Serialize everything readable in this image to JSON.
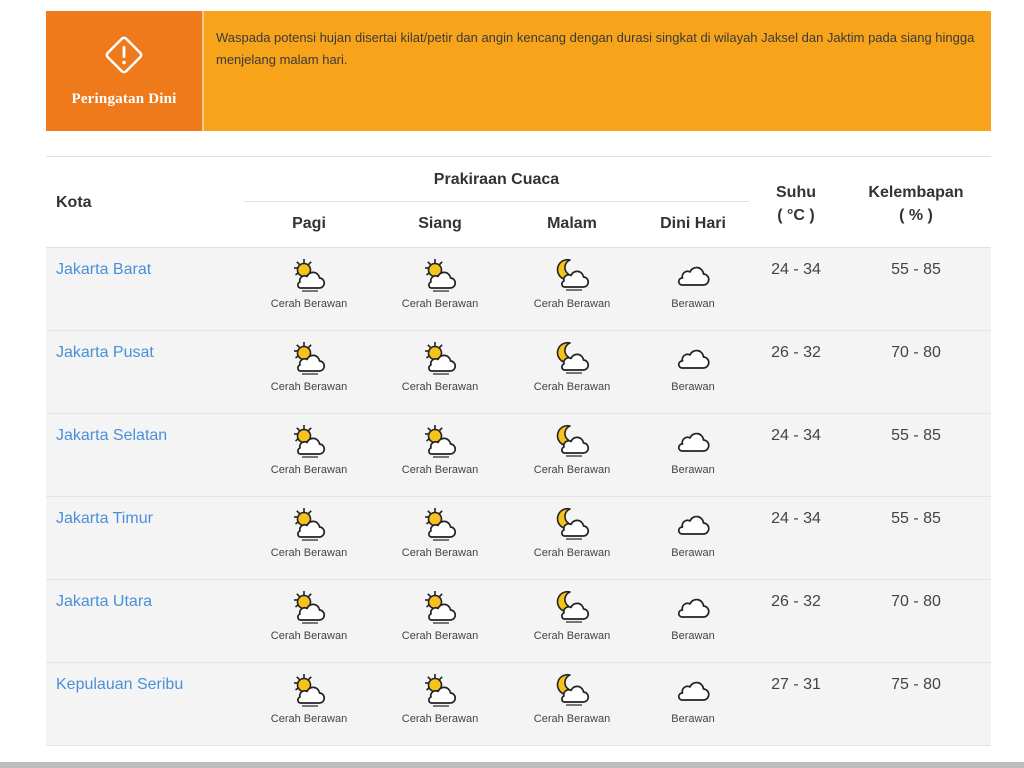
{
  "alert": {
    "title": "Peringatan Dini",
    "message": "Waspada potensi hujan disertai kilat/petir dan angin kencang dengan durasi singkat di wilayah Jaksel dan Jaktim pada siang hingga menjelang malam hari.",
    "icon": "warning-diamond-icon",
    "colors": {
      "main": "#f7a41b",
      "side": "#ee7a1c"
    }
  },
  "table": {
    "headers": {
      "kota": "Kota",
      "prakiraan": "Prakiraan Cuaca",
      "pagi": "Pagi",
      "siang": "Siang",
      "malam": "Malam",
      "dini_hari": "Dini Hari",
      "suhu": "Suhu",
      "suhu_unit": "( °C )",
      "kelembapan": "Kelembapan",
      "kelembapan_unit": "( % )"
    },
    "rows": [
      {
        "kota": "Jakarta Barat",
        "pagi": "Cerah Berawan",
        "siang": "Cerah Berawan",
        "malam": "Cerah Berawan",
        "dini_hari": "Berawan",
        "suhu": "24 - 34",
        "kelembapan": "55 - 85"
      },
      {
        "kota": "Jakarta Pusat",
        "pagi": "Cerah Berawan",
        "siang": "Cerah Berawan",
        "malam": "Cerah Berawan",
        "dini_hari": "Berawan",
        "suhu": "26 - 32",
        "kelembapan": "70 - 80"
      },
      {
        "kota": "Jakarta Selatan",
        "pagi": "Cerah Berawan",
        "siang": "Cerah Berawan",
        "malam": "Cerah Berawan",
        "dini_hari": "Berawan",
        "suhu": "24 - 34",
        "kelembapan": "55 - 85"
      },
      {
        "kota": "Jakarta Timur",
        "pagi": "Cerah Berawan",
        "siang": "Cerah Berawan",
        "malam": "Cerah Berawan",
        "dini_hari": "Berawan",
        "suhu": "24 - 34",
        "kelembapan": "55 - 85"
      },
      {
        "kota": "Jakarta Utara",
        "pagi": "Cerah Berawan",
        "siang": "Cerah Berawan",
        "malam": "Cerah Berawan",
        "dini_hari": "Berawan",
        "suhu": "26 - 32",
        "kelembapan": "70 - 80"
      },
      {
        "kota": "Kepulauan Seribu",
        "pagi": "Cerah Berawan",
        "siang": "Cerah Berawan",
        "malam": "Cerah Berawan",
        "dini_hari": "Berawan",
        "suhu": "27 - 31",
        "kelembapan": "75 - 80"
      }
    ],
    "icons": {
      "day": "sun-cloud-icon",
      "night": "moon-cloud-icon",
      "cloudy": "cloud-icon"
    },
    "colors": {
      "city_link": "#4a90d9",
      "row_bg": "#f4f4f4"
    }
  }
}
